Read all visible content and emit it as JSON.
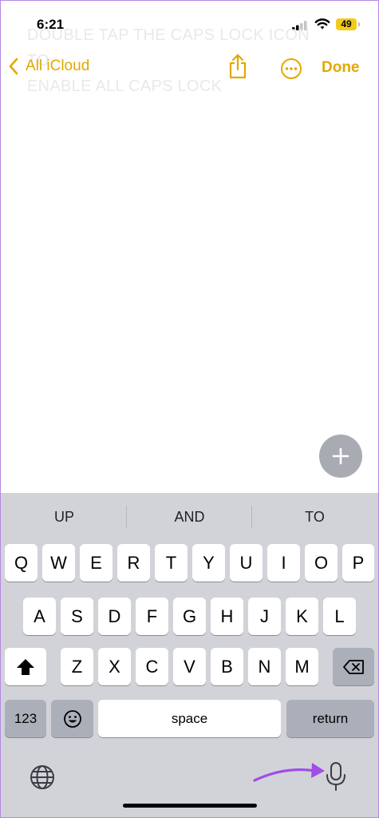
{
  "status_bar": {
    "time": "6:21",
    "battery": "49"
  },
  "background_text": {
    "line1": "DOUBLE TAP THE CAPS LOCK ICON TO",
    "line2": "ENABLE ALL CAPS LOCK"
  },
  "nav": {
    "back_label": "All iCloud",
    "done_label": "Done"
  },
  "colors": {
    "accent": "#e2a800",
    "keyboard_bg": "#d1d3d9",
    "annotation_arrow": "#a24de6"
  },
  "keyboard": {
    "suggestions": [
      "UP",
      "AND",
      "TO"
    ],
    "row1": [
      "Q",
      "W",
      "E",
      "R",
      "T",
      "Y",
      "U",
      "I",
      "O",
      "P"
    ],
    "row2": [
      "A",
      "S",
      "D",
      "F",
      "G",
      "H",
      "J",
      "K",
      "L"
    ],
    "row3": [
      "Z",
      "X",
      "C",
      "V",
      "B",
      "N",
      "M"
    ],
    "numbers_label": "123",
    "space_label": "space",
    "return_label": "return"
  },
  "icons": [
    "back-chevron-icon",
    "share-icon",
    "more-icon",
    "plus-icon",
    "shift-icon",
    "delete-icon",
    "emoji-icon",
    "globe-icon",
    "microphone-icon"
  ]
}
